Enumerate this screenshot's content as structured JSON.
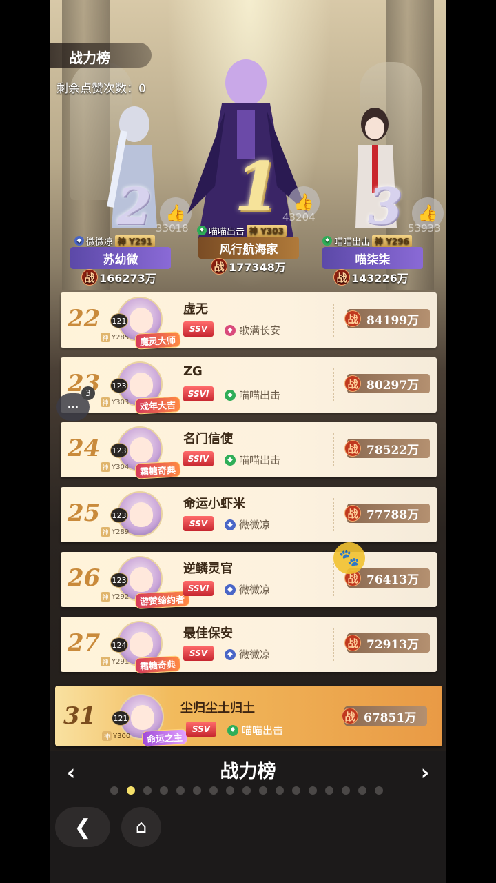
{
  "header": {
    "title": "战力榜",
    "likes_remaining": "剩余点赞次数：0"
  },
  "podium": [
    {
      "rank": "2",
      "likes": "33018",
      "guild": "微微凉",
      "vip": "神 Y291",
      "name": "苏幼微",
      "power": "166273万",
      "guild_color": "#4a66c7"
    },
    {
      "rank": "1",
      "likes": "43204",
      "guild": "喵喵出击",
      "vip": "神 Y303",
      "name": "风行航海家",
      "power": "177348万",
      "guild_color": "#2fae58"
    },
    {
      "rank": "3",
      "likes": "53933",
      "guild": "喵喵出击",
      "vip": "神 Y296",
      "name": "喵柒柒",
      "power": "143226万",
      "guild_color": "#2fae58"
    }
  ],
  "zhan_label": "战",
  "rows": [
    {
      "rank": "22",
      "level": "121",
      "vip": "Y285",
      "title": "魔灵大师",
      "name": "虚无",
      "sv": "SSV",
      "guild": "歌满长安",
      "guild_color": "#d94a7b",
      "power": "84199万"
    },
    {
      "rank": "23",
      "level": "123",
      "vip": "Y303",
      "title": "戏年大吉",
      "name": "ZG",
      "sv": "SSVI",
      "guild": "喵喵出击",
      "guild_color": "#2fae58",
      "power": "80297万"
    },
    {
      "rank": "24",
      "level": "123",
      "vip": "Y304",
      "title": "霜糖奇典",
      "name": "名门信使",
      "sv": "SSIV",
      "guild": "喵喵出击",
      "guild_color": "#2fae58",
      "power": "78522万"
    },
    {
      "rank": "25",
      "level": "123",
      "vip": "Y289",
      "title": "",
      "name": "命运小虾米",
      "sv": "SSV",
      "guild": "微微凉",
      "guild_color": "#4a66c7",
      "power": "77788万"
    },
    {
      "rank": "26",
      "level": "123",
      "vip": "Y292",
      "title": "游赞缔约者",
      "name": "逆鳞灵官",
      "sv": "SSVI",
      "guild": "微微凉",
      "guild_color": "#4a66c7",
      "power": "76413万"
    },
    {
      "rank": "27",
      "level": "124",
      "vip": "Y291",
      "title": "霜糖奇典",
      "name": "最佳保安",
      "sv": "SSV",
      "guild": "微微凉",
      "guild_color": "#4a66c7",
      "power": "72913万"
    }
  ],
  "me": {
    "rank": "31",
    "level": "121",
    "vip": "Y300",
    "title": "命运之主",
    "name": "尘归尘土归土",
    "sv": "SSV",
    "guild": "喵喵出击",
    "guild_color": "#2fae58",
    "power": "67851万"
  },
  "shen_label": "神",
  "chat_badge": "3",
  "bottom": {
    "title": "战力榜",
    "left_arrow": "‹",
    "right_arrow": "›",
    "back": "❮",
    "home": "⌂"
  },
  "pagination": {
    "total": 17,
    "active": 1
  }
}
